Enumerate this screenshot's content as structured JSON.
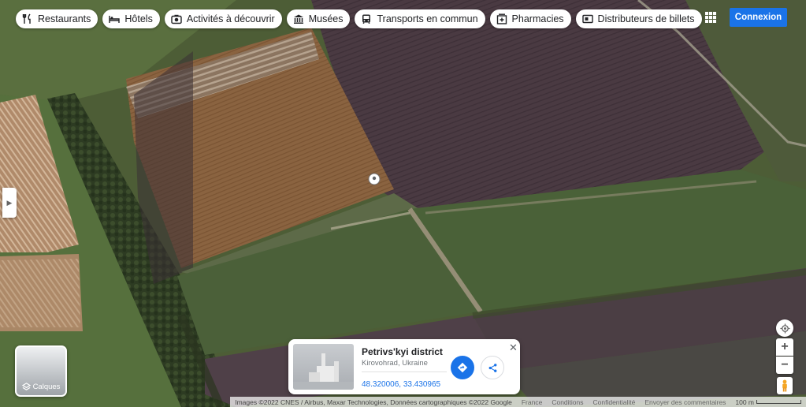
{
  "chips": [
    {
      "label": "Restaurants",
      "icon": "restaurant-icon"
    },
    {
      "label": "Hôtels",
      "icon": "hotel-icon"
    },
    {
      "label": "Activités à découvrir",
      "icon": "camera-icon"
    },
    {
      "label": "Musées",
      "icon": "museum-icon"
    },
    {
      "label": "Transports en commun",
      "icon": "bus-icon"
    },
    {
      "label": "Pharmacies",
      "icon": "pharmacy-icon"
    },
    {
      "label": "Distributeurs de billets",
      "icon": "atm-icon"
    }
  ],
  "header": {
    "signin_label": "Connexion",
    "apps_icon": "apps-grid-icon"
  },
  "layers": {
    "label": "Calques"
  },
  "place_card": {
    "title": "Petrivs'kyi district",
    "subtitle": "Kirovohrad, Ukraine",
    "coordinates": "48.320006, 33.430965",
    "directions_icon": "directions-icon",
    "share_icon": "share-icon",
    "close_icon": "close-icon"
  },
  "map_controls": {
    "zoom_in": "+",
    "zoom_out": "−"
  },
  "footer": {
    "attribution": "Images ©2022 CNES / Airbus, Maxar Technologies, Données cartographiques ©2022 Google",
    "country": "France",
    "conditions": "Conditions",
    "privacy": "Confidentialité",
    "feedback": "Envoyer des commentaires",
    "scale": "100 m"
  },
  "colors": {
    "accent": "#1a73e8"
  }
}
